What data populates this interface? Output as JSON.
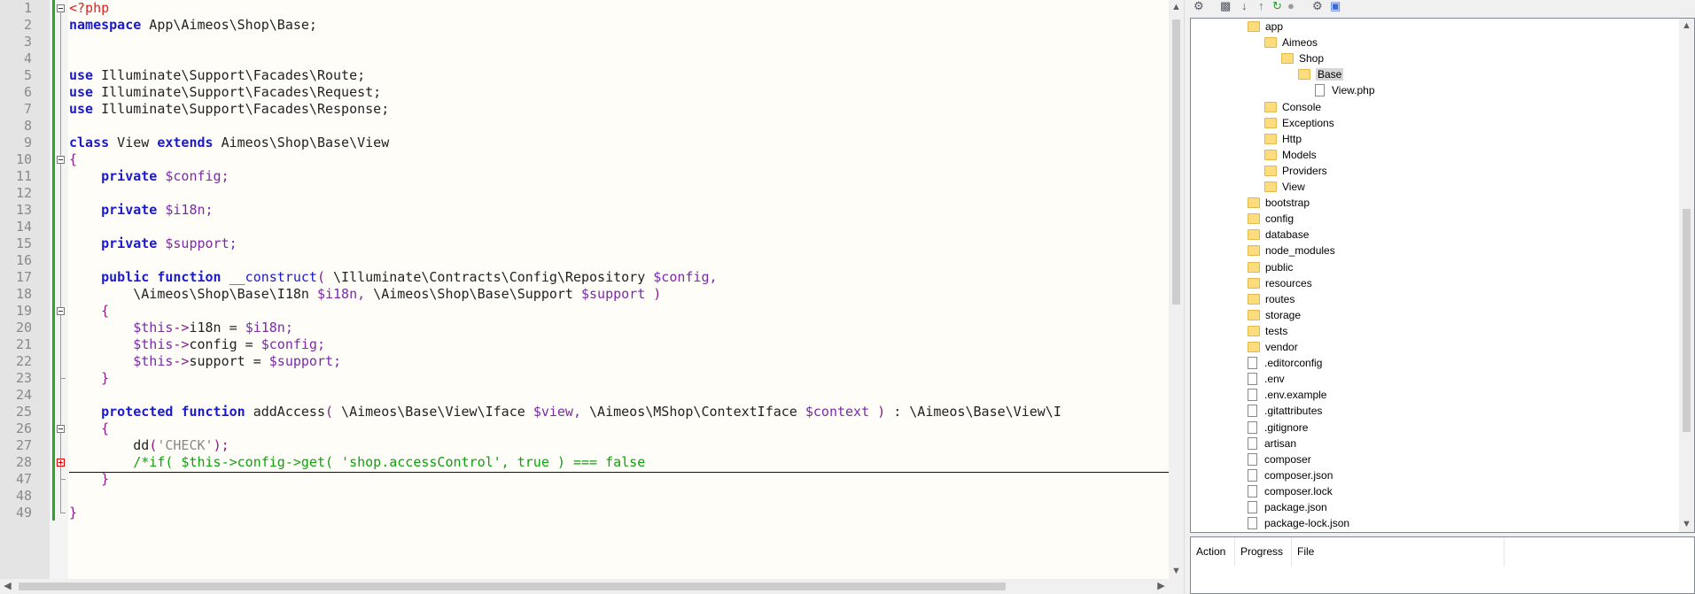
{
  "editor": {
    "lines": [
      {
        "num": "1",
        "segs": [
          [
            "php",
            "<?php"
          ]
        ]
      },
      {
        "num": "2",
        "segs": [
          [
            "kw",
            "namespace"
          ],
          [
            "",
            " App\\Aimeos\\Shop\\Base;"
          ]
        ]
      },
      {
        "num": "3",
        "segs": []
      },
      {
        "num": "4",
        "segs": []
      },
      {
        "num": "5",
        "segs": [
          [
            "kw",
            "use"
          ],
          [
            "",
            " Illuminate\\Support\\Facades\\Route;"
          ]
        ]
      },
      {
        "num": "6",
        "segs": [
          [
            "kw",
            "use"
          ],
          [
            "",
            " Illuminate\\Support\\Facades\\Request;"
          ]
        ]
      },
      {
        "num": "7",
        "segs": [
          [
            "kw",
            "use"
          ],
          [
            "",
            " Illuminate\\Support\\Facades\\Response;"
          ]
        ]
      },
      {
        "num": "8",
        "segs": []
      },
      {
        "num": "9",
        "segs": [
          [
            "kw",
            "class"
          ],
          [
            "",
            " View "
          ],
          [
            "kw",
            "extends"
          ],
          [
            "",
            " Aimeos\\Shop\\Base\\View"
          ]
        ]
      },
      {
        "num": "10",
        "segs": [
          [
            "op",
            "{"
          ]
        ]
      },
      {
        "num": "11",
        "segs": [
          [
            "",
            "    "
          ],
          [
            "kw",
            "private"
          ],
          [
            "",
            " "
          ],
          [
            "var",
            "$config;"
          ]
        ]
      },
      {
        "num": "12",
        "segs": []
      },
      {
        "num": "13",
        "segs": [
          [
            "",
            "    "
          ],
          [
            "kw",
            "private"
          ],
          [
            "",
            " "
          ],
          [
            "var",
            "$i18n;"
          ]
        ]
      },
      {
        "num": "14",
        "segs": []
      },
      {
        "num": "15",
        "segs": [
          [
            "",
            "    "
          ],
          [
            "kw",
            "private"
          ],
          [
            "",
            " "
          ],
          [
            "var",
            "$support;"
          ]
        ]
      },
      {
        "num": "16",
        "segs": []
      },
      {
        "num": "17",
        "segs": [
          [
            "",
            "    "
          ],
          [
            "kw",
            "public"
          ],
          [
            "",
            " "
          ],
          [
            "kw",
            "function"
          ],
          [
            "",
            " "
          ],
          [
            "kw2",
            "__construct"
          ],
          [
            "op",
            "("
          ],
          [
            "",
            " \\Illuminate\\Contracts\\Config\\Repository "
          ],
          [
            "var",
            "$config,"
          ]
        ]
      },
      {
        "num": "18",
        "segs": [
          [
            "",
            "        \\Aimeos\\Shop\\Base\\I18n "
          ],
          [
            "var",
            "$i18n,"
          ],
          [
            "",
            " \\Aimeos\\Shop\\Base\\Support "
          ],
          [
            "var",
            "$support"
          ],
          [
            "op",
            " )"
          ]
        ]
      },
      {
        "num": "19",
        "segs": [
          [
            "",
            "    "
          ],
          [
            "op",
            "{"
          ]
        ]
      },
      {
        "num": "20",
        "segs": [
          [
            "",
            "        "
          ],
          [
            "var",
            "$this"
          ],
          [
            "op",
            "->"
          ],
          [
            "",
            "i18n = "
          ],
          [
            "var",
            "$i18n;"
          ]
        ]
      },
      {
        "num": "21",
        "segs": [
          [
            "",
            "        "
          ],
          [
            "var",
            "$this"
          ],
          [
            "op",
            "->"
          ],
          [
            "",
            "config = "
          ],
          [
            "var",
            "$config;"
          ]
        ]
      },
      {
        "num": "22",
        "segs": [
          [
            "",
            "        "
          ],
          [
            "var",
            "$this"
          ],
          [
            "op",
            "->"
          ],
          [
            "",
            "support = "
          ],
          [
            "var",
            "$support;"
          ]
        ]
      },
      {
        "num": "23",
        "segs": [
          [
            "",
            "    "
          ],
          [
            "op",
            "}"
          ]
        ]
      },
      {
        "num": "24",
        "segs": []
      },
      {
        "num": "25",
        "segs": [
          [
            "",
            "    "
          ],
          [
            "kw",
            "protected"
          ],
          [
            "",
            " "
          ],
          [
            "kw",
            "function"
          ],
          [
            "",
            " addAccess"
          ],
          [
            "op",
            "("
          ],
          [
            "",
            " \\Aimeos\\Base\\View\\Iface "
          ],
          [
            "var",
            "$view,"
          ],
          [
            "",
            " \\Aimeos\\MShop\\ContextIface "
          ],
          [
            "var",
            "$context"
          ],
          [
            "op",
            " )"
          ],
          [
            "",
            " : \\Aimeos\\Base\\View\\I"
          ]
        ]
      },
      {
        "num": "26",
        "segs": [
          [
            "",
            "    "
          ],
          [
            "op",
            "{"
          ]
        ]
      },
      {
        "num": "27",
        "segs": [
          [
            "",
            "        dd"
          ],
          [
            "op",
            "("
          ],
          [
            "str",
            "'CHECK'"
          ],
          [
            "op",
            ");"
          ]
        ]
      },
      {
        "num": "28",
        "segs": [
          [
            "",
            "        "
          ],
          [
            "cm",
            "/*if( $this->config->get( 'shop.accessControl', true ) === false"
          ]
        ]
      },
      {
        "num": "47",
        "segs": [
          [
            "",
            "    "
          ],
          [
            "op",
            "}"
          ]
        ]
      },
      {
        "num": "48",
        "segs": []
      },
      {
        "num": "49",
        "segs": [
          [
            "op",
            "}"
          ]
        ]
      }
    ]
  },
  "tree": {
    "items": [
      {
        "label": "app",
        "type": "folder",
        "indent": 1
      },
      {
        "label": "Aimeos",
        "type": "folder",
        "indent": 2
      },
      {
        "label": "Shop",
        "type": "folder",
        "indent": 3
      },
      {
        "label": "Base",
        "type": "folder",
        "indent": 4,
        "selected": true
      },
      {
        "label": "View.php",
        "type": "file",
        "indent": 5
      },
      {
        "label": "Console",
        "type": "folder",
        "indent": 2
      },
      {
        "label": "Exceptions",
        "type": "folder",
        "indent": 2
      },
      {
        "label": "Http",
        "type": "folder",
        "indent": 2
      },
      {
        "label": "Models",
        "type": "folder",
        "indent": 2
      },
      {
        "label": "Providers",
        "type": "folder",
        "indent": 2
      },
      {
        "label": "View",
        "type": "folder",
        "indent": 2
      },
      {
        "label": "bootstrap",
        "type": "folder",
        "indent": 1
      },
      {
        "label": "config",
        "type": "folder",
        "indent": 1
      },
      {
        "label": "database",
        "type": "folder",
        "indent": 1
      },
      {
        "label": "node_modules",
        "type": "folder",
        "indent": 1
      },
      {
        "label": "public",
        "type": "folder",
        "indent": 1
      },
      {
        "label": "resources",
        "type": "folder",
        "indent": 1
      },
      {
        "label": "routes",
        "type": "folder",
        "indent": 1
      },
      {
        "label": "storage",
        "type": "folder",
        "indent": 1
      },
      {
        "label": "tests",
        "type": "folder",
        "indent": 1
      },
      {
        "label": "vendor",
        "type": "folder",
        "indent": 1
      },
      {
        "label": ".editorconfig",
        "type": "file",
        "indent": 1
      },
      {
        "label": ".env",
        "type": "file",
        "indent": 1
      },
      {
        "label": ".env.example",
        "type": "file",
        "indent": 1
      },
      {
        "label": ".gitattributes",
        "type": "file",
        "indent": 1
      },
      {
        "label": ".gitignore",
        "type": "file",
        "indent": 1
      },
      {
        "label": "artisan",
        "type": "file",
        "indent": 1
      },
      {
        "label": "composer",
        "type": "file",
        "indent": 1
      },
      {
        "label": "composer.json",
        "type": "file",
        "indent": 1
      },
      {
        "label": "composer.lock",
        "type": "file",
        "indent": 1
      },
      {
        "label": "package.json",
        "type": "file",
        "indent": 1
      },
      {
        "label": "package-lock.json",
        "type": "file",
        "indent": 1
      }
    ]
  },
  "queue": {
    "columns": [
      "Action",
      "Progress",
      "File"
    ]
  },
  "icons": {
    "toolbar": [
      "plug-icon",
      "printer-icon",
      "download-icon",
      "upload-icon",
      "sync-icon",
      "stop-icon",
      "settings-icon",
      "panel-icon"
    ]
  }
}
